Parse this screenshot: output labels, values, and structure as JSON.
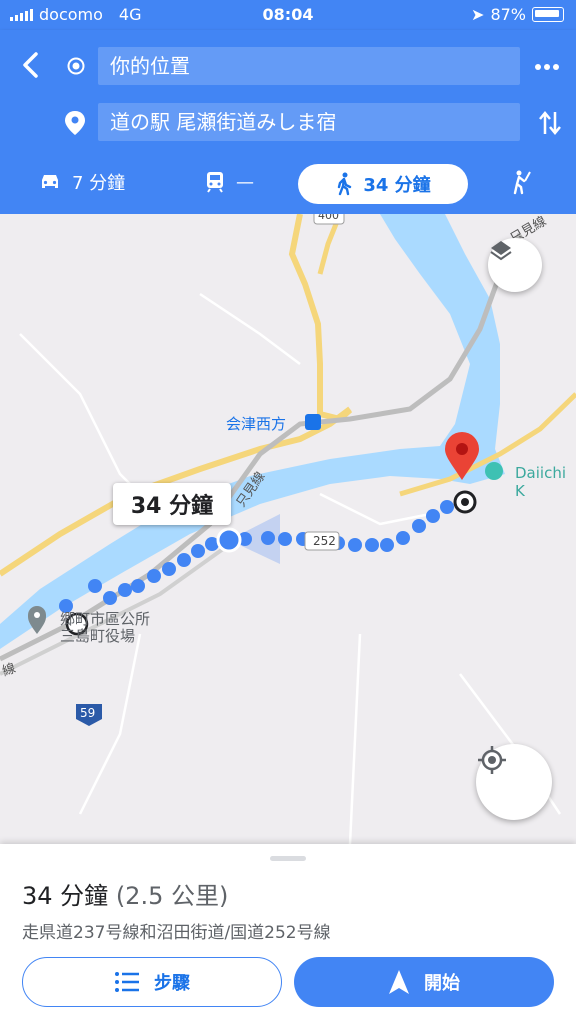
{
  "status": {
    "carrier": "docomo",
    "network": "4G",
    "time": "08:04",
    "battery": "87%"
  },
  "search": {
    "origin": "你的位置",
    "destination": "道の駅 尾瀬街道みしま宿"
  },
  "modes": [
    {
      "icon": "car-icon",
      "label": "7 分鐘"
    },
    {
      "icon": "train-icon",
      "label": "—"
    },
    {
      "icon": "walk-icon",
      "label": "34 分鐘",
      "selected": true
    },
    {
      "icon": "ride-icon",
      "label": ""
    }
  ],
  "map": {
    "callout": "34 分鐘",
    "labels": {
      "station": "会津西方",
      "poi": "Daiichi K",
      "office_1": "郷町市區公所",
      "office_2": "三島町役場",
      "road_252": "252",
      "road_59": "59",
      "road_400": "400",
      "rail_1": "只見線",
      "rail_2": "只見線",
      "rail_3": "線"
    }
  },
  "sheet": {
    "time": "34 分鐘",
    "distance": "(2.5 公里)",
    "via": "走県道237号線和沼田街道/国道252号線",
    "steps_label": "步驟",
    "start_label": "開始"
  },
  "colors": {
    "primary": "#4285f4",
    "route": "#4285f4",
    "water": "#aadaff",
    "highway": "#fde293",
    "pin": "#ea4335"
  }
}
